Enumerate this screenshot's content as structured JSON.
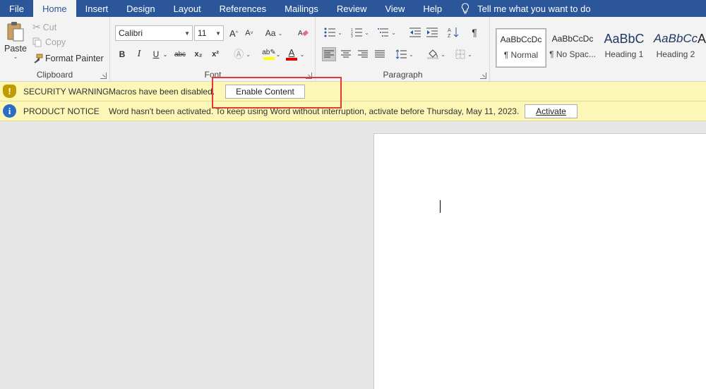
{
  "tabs": [
    "File",
    "Home",
    "Insert",
    "Design",
    "Layout",
    "References",
    "Mailings",
    "Review",
    "View",
    "Help"
  ],
  "active_tab": "Home",
  "tell_me": "Tell me what you want to do",
  "clipboard": {
    "paste": "Paste",
    "cut": "Cut",
    "copy": "Copy",
    "format_painter": "Format Painter",
    "label": "Clipboard"
  },
  "font": {
    "family": "Calibri",
    "size": "11",
    "label": "Font",
    "change_case": "Aa",
    "bold": "B",
    "italic": "I",
    "underline": "U",
    "strikethrough": "abc",
    "subscript": "x₂",
    "superscript": "x²",
    "grow": "A",
    "shrink": "A"
  },
  "paragraph": {
    "label": "Paragraph"
  },
  "styles": [
    {
      "sample": "AaBbCcDc",
      "name": "¶ Normal"
    },
    {
      "sample": "AaBbCcDc",
      "name": "¶ No Spac..."
    },
    {
      "sample": "AaBbC",
      "name": "Heading 1"
    },
    {
      "sample": "AaBbCc",
      "name": "Heading 2"
    },
    {
      "sample": "A",
      "name": ""
    }
  ],
  "security_bar": {
    "title": "SECURITY WARNING",
    "text": "Macros have been disabled.",
    "button": "Enable Content"
  },
  "notice_bar": {
    "title": "PRODUCT NOTICE",
    "text": "Word hasn't been activated. To keep using Word without interruption, activate before Thursday, May 11, 2023.",
    "button": "Activate"
  },
  "colors": {
    "tab_bar": "#2b579a",
    "warning_bg": "#fcf7b6",
    "warning_icon": "#c19c00",
    "info_icon": "#2b6cc4",
    "highlight": "#e53935",
    "font_color_bar": "#e00000",
    "highlight_color_bar": "#ffff00"
  }
}
